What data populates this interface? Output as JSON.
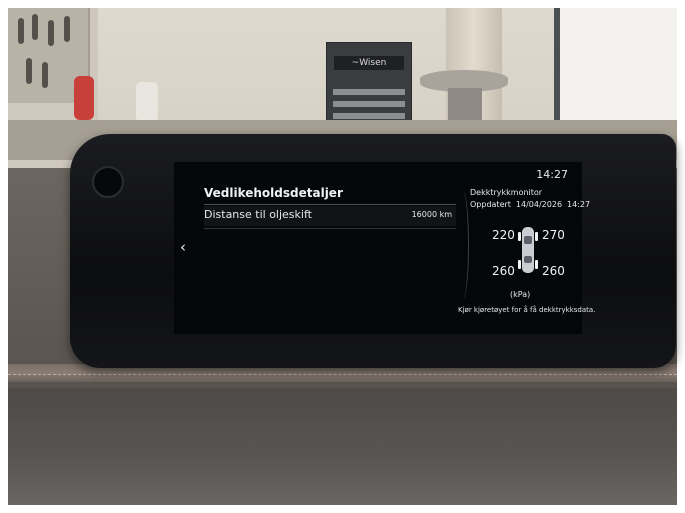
{
  "status_bar": {
    "clock": "14:27"
  },
  "maintenance": {
    "title": "Vedlikeholdsdetaljer",
    "rows": [
      {
        "label": "Distanse til oljeskift",
        "value": "16000 km"
      }
    ]
  },
  "tpms": {
    "title": "Dekktrykkmonitor",
    "updated_label": "Oppdatert",
    "updated_date": "14/04/2026",
    "updated_time": "14:27",
    "front_left": "220",
    "front_right": "270",
    "rear_left": "260",
    "rear_right": "260",
    "unit": "(kPa)",
    "note": "Kjør kjøretøyet for å få dekktrykksdata."
  },
  "background": {
    "toolbox_label": "~Wisen"
  },
  "icons": {
    "back": "chevron-left-icon",
    "car": "car-top-view-icon",
    "camera": "camera-sensor-icon"
  },
  "colors": {
    "screen_bg": "#050608",
    "text": "#e9ebee"
  }
}
